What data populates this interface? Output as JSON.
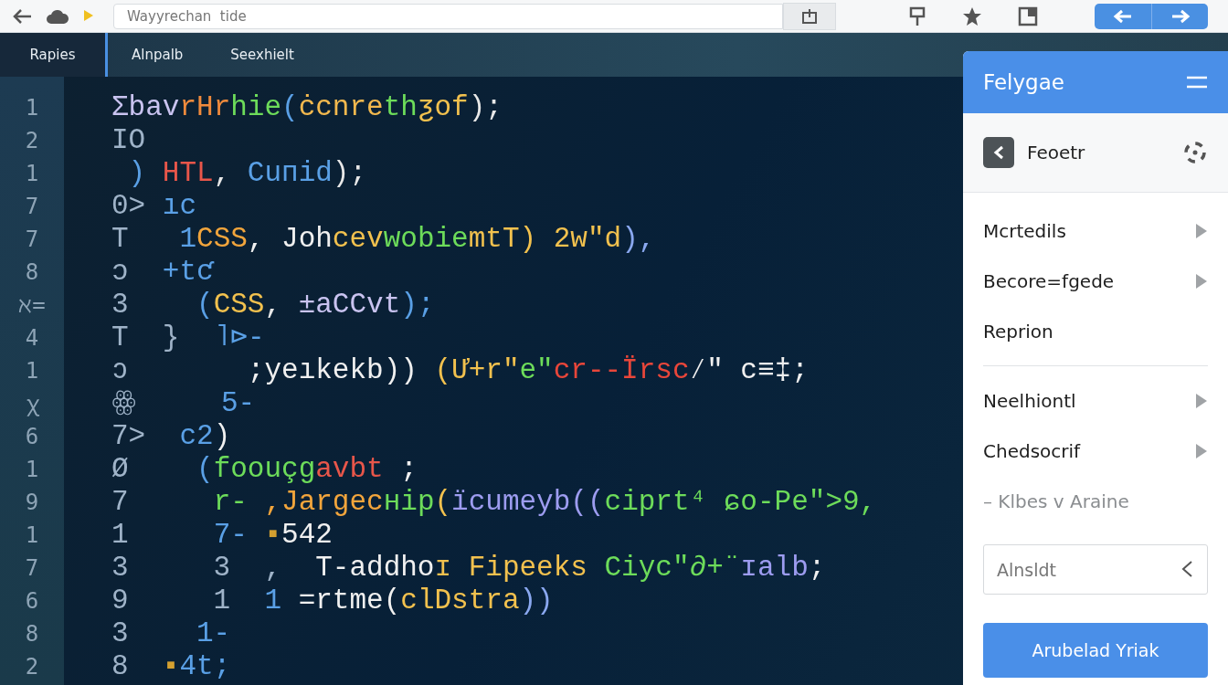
{
  "toolbar": {
    "address": {
      "value": "Wayyrechan  tide"
    }
  },
  "tabs": [
    {
      "label": "Rapies",
      "selected": true
    },
    {
      "label": "Alnpalb",
      "selected": false
    },
    {
      "label": "Seexhielt",
      "selected": false
    }
  ],
  "editor": {
    "lines": [
      {
        "number": "1",
        "tokens": [
          {
            "text": "Σbav",
            "color": "#c9c3f0"
          },
          {
            "text": "rHr",
            "color": "#f08a3c"
          },
          {
            "text": "hie",
            "color": "#6ddc5a"
          },
          {
            "text": "(",
            "color": "#5aa0e6"
          },
          {
            "text": "ċcnre",
            "color": "#f2b84e"
          },
          {
            "text": "th",
            "color": "#6ddc5a"
          },
          {
            "text": "ƺof",
            "color": "#f2c14e"
          },
          {
            "text": ");",
            "color": "#e8e8e8"
          }
        ]
      },
      {
        "number": "2",
        "tokens": [
          {
            "text": "IO",
            "color": "#9fb3c8"
          }
        ]
      },
      {
        "number": "1",
        "tokens": [
          {
            "text": " ) ",
            "color": "#5aa0e6"
          },
          {
            "text": "HTL",
            "color": "#e8564a"
          },
          {
            "text": ", ",
            "color": "#e8e8e8"
          },
          {
            "text": "Cuпid",
            "color": "#5aa0e6"
          },
          {
            "text": ");",
            "color": "#e8e8e8"
          }
        ]
      },
      {
        "number": "7",
        "tokens": [
          {
            "text": "0> ",
            "color": "#9fb3c8"
          },
          {
            "text": "ıc",
            "color": "#5aa0e6"
          }
        ]
      },
      {
        "number": "7",
        "tokens": [
          {
            "text": "T   ",
            "color": "#9fb3c8"
          },
          {
            "text": "1",
            "color": "#5aa0e6"
          },
          {
            "text": "CSS",
            "color": "#f2a53c"
          },
          {
            "text": ", Joh",
            "color": "#f0f0f0"
          },
          {
            "text": "cev",
            "color": "#f2c14e"
          },
          {
            "text": "wobie",
            "color": "#6ddc5a"
          },
          {
            "text": "mtT) 2w\"d",
            "color": "#f2c14e"
          },
          {
            "text": "),",
            "color": "#8aa8f0"
          }
        ]
      },
      {
        "number": "8",
        "tokens": [
          {
            "text": "ɔ  ",
            "color": "#9fb3c8"
          },
          {
            "text": "+tƈ",
            "color": "#5aa0e6"
          }
        ]
      },
      {
        "number": "ℵ=",
        "tokens": [
          {
            "text": "3    ",
            "color": "#9fb3c8"
          },
          {
            "text": "(",
            "color": "#5aa0e6"
          },
          {
            "text": "CSS",
            "color": "#f2c14e"
          },
          {
            "text": ", ",
            "color": "#e8e8e8"
          },
          {
            "text": "±aCCvt",
            "color": "#c9c3f0"
          },
          {
            "text": ");",
            "color": "#5aa0e6"
          }
        ]
      },
      {
        "number": "4",
        "tokens": [
          {
            "text": "T  }  ",
            "color": "#9fb3c8"
          },
          {
            "text": "˥⊳-",
            "color": "#5aa0e6"
          }
        ]
      },
      {
        "number": "1",
        "tokens": [
          {
            "text": "ↄ       ",
            "color": "#9fb3c8"
          },
          {
            "text": ";yeıkekb)) ",
            "color": "#f0f0f0"
          },
          {
            "text": "(Ư+r\"",
            "color": "#f2c14e"
          },
          {
            "text": "e\"",
            "color": "#6ddc5a"
          },
          {
            "text": "cr--Ïrsc",
            "color": "#e8463a"
          },
          {
            "text": "⁄\" c≡‡;",
            "color": "#f0f0f0"
          }
        ]
      },
      {
        "number": "ꭓ",
        "tokens": [
          {
            "text": "ꙮ     ",
            "color": "#9fb3c8"
          },
          {
            "text": "5-",
            "color": "#5aa0e6"
          }
        ]
      },
      {
        "number": "6",
        "tokens": [
          {
            "text": "7>  ",
            "color": "#9fb3c8"
          },
          {
            "text": "c2",
            "color": "#5aa0e6"
          },
          {
            "text": ")",
            "color": "#f0f0f0"
          }
        ]
      },
      {
        "number": "1",
        "tokens": [
          {
            "text": "Ø    ",
            "color": "#9fb3c8"
          },
          {
            "text": "(",
            "color": "#5aa0e6"
          },
          {
            "text": "foouçg",
            "color": "#6ddc5a"
          },
          {
            "text": "avbt",
            "color": "#e8564a"
          },
          {
            "text": " ;",
            "color": "#f0f0f0"
          }
        ]
      },
      {
        "number": "9",
        "tokens": [
          {
            "text": "7     ",
            "color": "#9fb3c8"
          },
          {
            "text": "r- ",
            "color": "#6ddc5a"
          },
          {
            "text": ",Jargec",
            "color": "#f2a53c"
          },
          {
            "text": "ʜip",
            "color": "#6ddc5a"
          },
          {
            "text": "(",
            "color": "#f2c14e"
          },
          {
            "text": "ïcumeyb((",
            "color": "#9d9cf0"
          },
          {
            "text": "ciprt⁴ ",
            "color": "#6ddc5a"
          },
          {
            "text": "ɕo-Pe\">9,",
            "color": "#6ddc5a"
          }
        ]
      },
      {
        "number": "1",
        "tokens": [
          {
            "text": "1     ",
            "color": "#9fb3c8"
          },
          {
            "text": "7- ",
            "color": "#5aa0e6"
          },
          {
            "text": "▪",
            "color": "#d4a030"
          },
          {
            "text": "542",
            "color": "#f0f0f0"
          }
        ]
      },
      {
        "number": "7",
        "tokens": [
          {
            "text": "3     3  ,  ",
            "color": "#9fb3c8"
          },
          {
            "text": "T-addho",
            "color": "#f0f0f0"
          },
          {
            "text": "ɪ Fipeeks ",
            "color": "#f2c14e"
          },
          {
            "text": "Ciyc\"∂+¨",
            "color": "#6ddc5a"
          },
          {
            "text": "ɪalb",
            "color": "#9d9cf0"
          },
          {
            "text": ";",
            "color": "#f0f0f0"
          }
        ]
      },
      {
        "number": "6",
        "tokens": [
          {
            "text": "9     1  ",
            "color": "#9fb3c8"
          },
          {
            "text": "1 ",
            "color": "#5aa0e6"
          },
          {
            "text": "=rtme(",
            "color": "#f0f0f0"
          },
          {
            "text": "clDstra",
            "color": "#f2c14e"
          },
          {
            "text": "))",
            "color": "#8aa8f0"
          }
        ]
      },
      {
        "number": "8",
        "tokens": [
          {
            "text": "3    ",
            "color": "#9fb3c8"
          },
          {
            "text": "1-",
            "color": "#5aa0e6"
          }
        ]
      },
      {
        "number": "2",
        "tokens": [
          {
            "text": "8  ",
            "color": "#9fb3c8"
          },
          {
            "text": "▪",
            "color": "#d4a030"
          },
          {
            "text": "4t;",
            "color": "#5aa0e6"
          }
        ]
      }
    ]
  },
  "panel": {
    "title": "Felygae",
    "subtitle": "Feoetr",
    "menu_groups": [
      [
        {
          "label": "Mcrtedils",
          "submenu": true,
          "disabled": false
        },
        {
          "label": "Becore=fgede",
          "submenu": true,
          "disabled": false
        },
        {
          "label": "Reprion",
          "submenu": false,
          "disabled": false
        }
      ],
      [
        {
          "label": "Neelhiontl",
          "submenu": true,
          "disabled": false
        },
        {
          "label": "Chedsocrif",
          "submenu": true,
          "disabled": false
        },
        {
          "label": "– Klbes v Araine",
          "submenu": false,
          "disabled": true
        }
      ]
    ],
    "field": {
      "placeholder": "Alnsldt"
    },
    "button": "Arubelad Yriak"
  }
}
